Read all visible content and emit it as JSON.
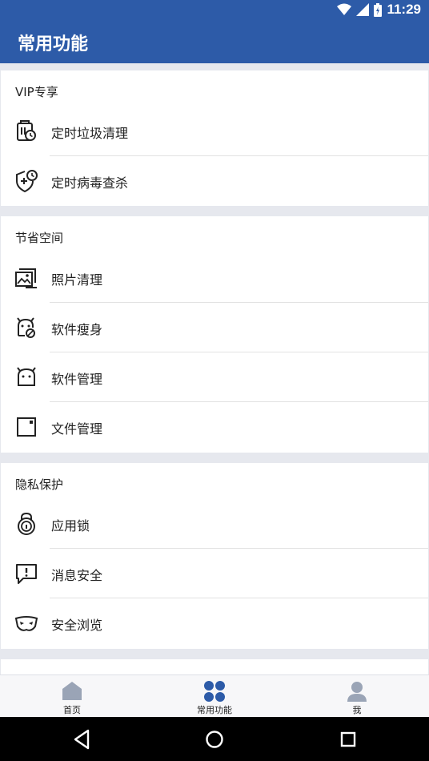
{
  "status_bar": {
    "time": "11:29"
  },
  "app_bar": {
    "title": "常用功能"
  },
  "sections": [
    {
      "title": "VIP专享",
      "items": [
        {
          "label": "定时垃圾清理",
          "icon": "scheduled-cleanup-icon"
        },
        {
          "label": "定时病毒查杀",
          "icon": "scheduled-antivirus-icon"
        }
      ]
    },
    {
      "title": "节省空间",
      "items": [
        {
          "label": "照片清理",
          "icon": "photo-cleanup-icon"
        },
        {
          "label": "软件瘦身",
          "icon": "app-slimming-icon"
        },
        {
          "label": "软件管理",
          "icon": "app-manager-icon"
        },
        {
          "label": "文件管理",
          "icon": "file-manager-icon"
        }
      ]
    },
    {
      "title": "隐私保护",
      "items": [
        {
          "label": "应用锁",
          "icon": "app-lock-icon"
        },
        {
          "label": "消息安全",
          "icon": "message-security-icon"
        },
        {
          "label": "安全浏览",
          "icon": "safe-browsing-icon"
        }
      ]
    }
  ],
  "tabs": [
    {
      "label": "首页",
      "icon": "home-icon"
    },
    {
      "label": "常用功能",
      "icon": "features-grid-icon"
    },
    {
      "label": "我",
      "icon": "profile-icon"
    }
  ],
  "colors": {
    "primary": "#2d5ba8",
    "tab_active": "#2d5ba8",
    "tab_inactive": "#9aa4b6"
  }
}
